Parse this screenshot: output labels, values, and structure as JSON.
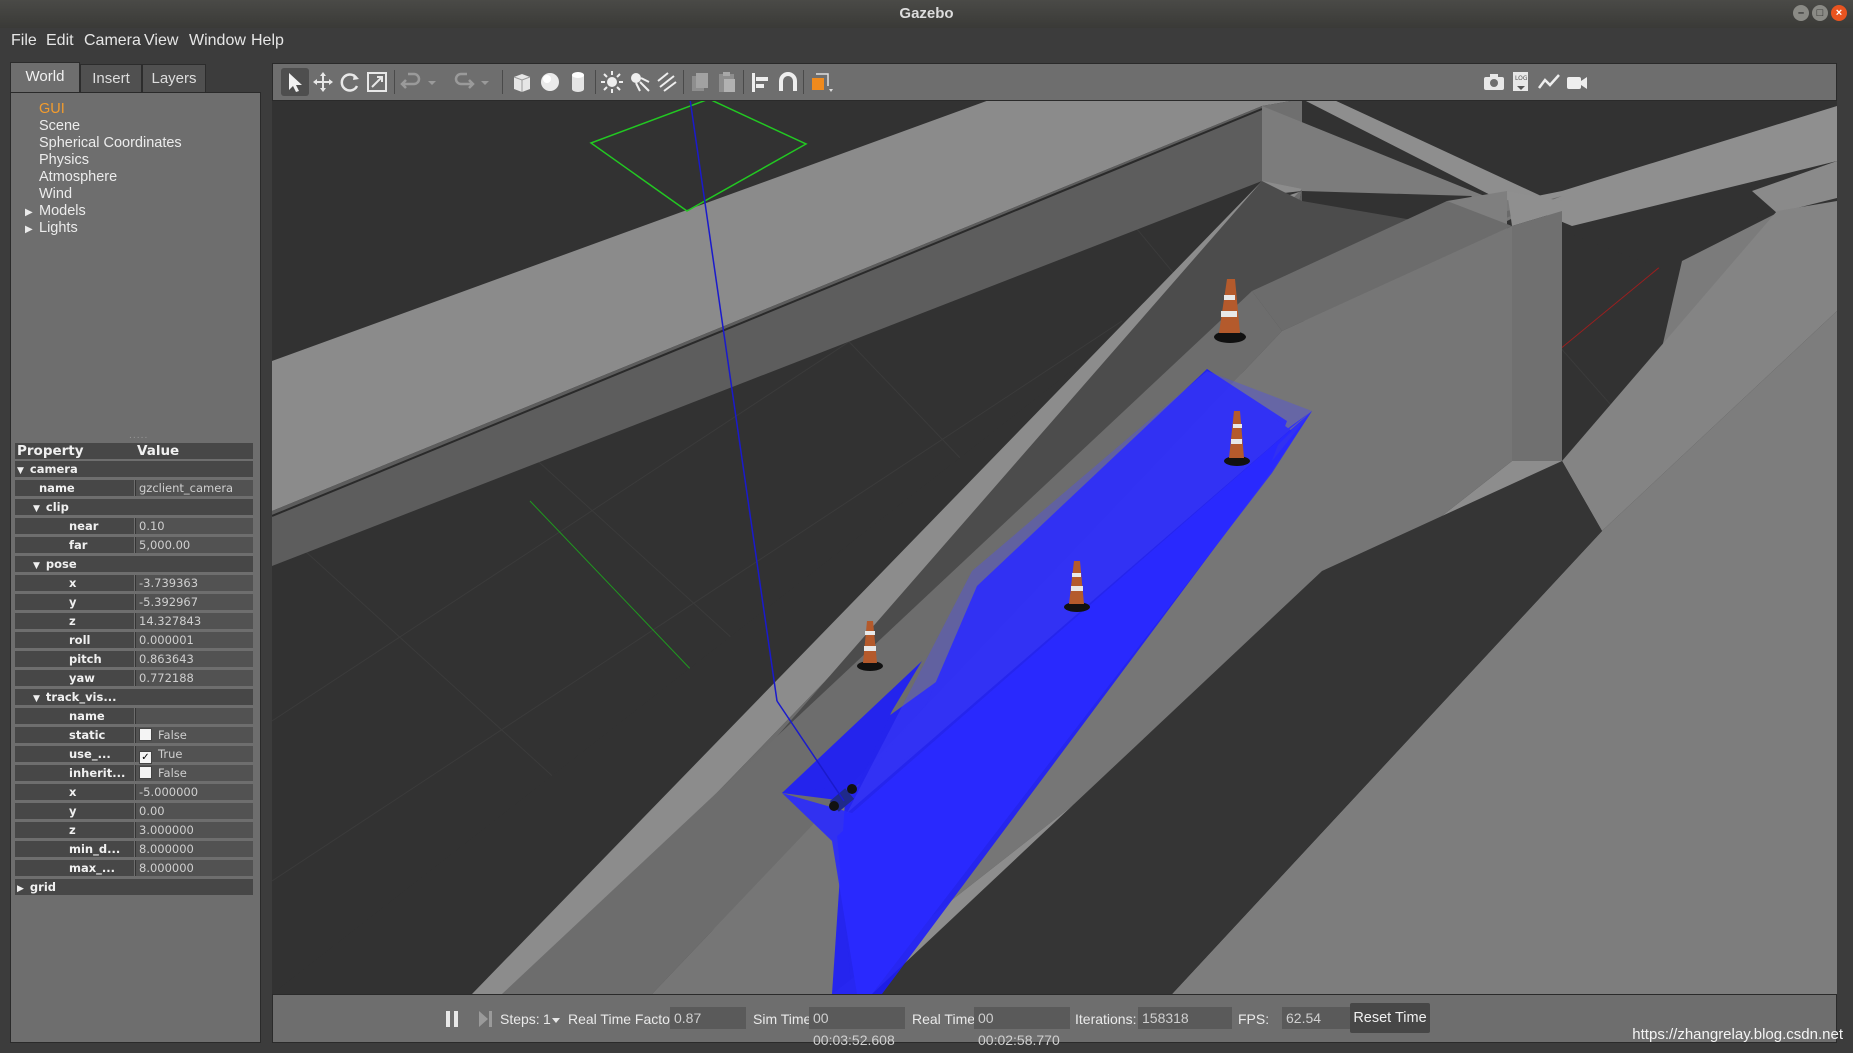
{
  "window": {
    "title": "Gazebo"
  },
  "menu": [
    "File",
    "Edit",
    "Camera",
    "View",
    "Window",
    "Help"
  ],
  "left_panel": {
    "tabs": [
      "World",
      "Insert",
      "Layers"
    ],
    "active_tab": "World",
    "tree": [
      {
        "label": "GUI",
        "selected": true,
        "expandable": false
      },
      {
        "label": "Scene",
        "selected": false,
        "expandable": false
      },
      {
        "label": "Spherical Coordinates",
        "selected": false,
        "expandable": false
      },
      {
        "label": "Physics",
        "selected": false,
        "expandable": false
      },
      {
        "label": "Atmosphere",
        "selected": false,
        "expandable": false
      },
      {
        "label": "Wind",
        "selected": false,
        "expandable": false
      },
      {
        "label": "Models",
        "selected": false,
        "expandable": true
      },
      {
        "label": "Lights",
        "selected": false,
        "expandable": true
      }
    ],
    "property_header": {
      "property": "Property",
      "value": "Value"
    },
    "properties": [
      {
        "type": "group",
        "label": "camera",
        "level": 0,
        "expanded": true
      },
      {
        "type": "row",
        "label": "name",
        "value": "gzclient_camera",
        "level": 1
      },
      {
        "type": "group",
        "label": "clip",
        "level": 1,
        "expanded": true
      },
      {
        "type": "row",
        "label": "near",
        "value": "0.10",
        "level": 2
      },
      {
        "type": "row",
        "label": "far",
        "value": "5,000.00",
        "level": 2
      },
      {
        "type": "group",
        "label": "pose",
        "level": 1,
        "expanded": true
      },
      {
        "type": "row",
        "label": "x",
        "value": "-3.739363",
        "level": 2
      },
      {
        "type": "row",
        "label": "y",
        "value": "-5.392967",
        "level": 2
      },
      {
        "type": "row",
        "label": "z",
        "value": "14.327843",
        "level": 2
      },
      {
        "type": "row",
        "label": "roll",
        "value": "0.000001",
        "level": 2
      },
      {
        "type": "row",
        "label": "pitch",
        "value": "0.863643",
        "level": 2
      },
      {
        "type": "row",
        "label": "yaw",
        "value": "0.772188",
        "level": 2
      },
      {
        "type": "group",
        "label": "track_vis...",
        "level": 1,
        "expanded": true
      },
      {
        "type": "row",
        "label": "name",
        "value": "",
        "level": 2
      },
      {
        "type": "check",
        "label": "static",
        "value": "False",
        "checked": false,
        "level": 2
      },
      {
        "type": "check",
        "label": "use_...",
        "value": "True",
        "checked": true,
        "level": 2
      },
      {
        "type": "check",
        "label": "inherit...",
        "value": "False",
        "checked": false,
        "level": 2
      },
      {
        "type": "row",
        "label": "x",
        "value": "-5.000000",
        "level": 2
      },
      {
        "type": "row",
        "label": "y",
        "value": "0.00",
        "level": 2
      },
      {
        "type": "row",
        "label": "z",
        "value": "3.000000",
        "level": 2
      },
      {
        "type": "row",
        "label": "min_d...",
        "value": "8.000000",
        "level": 2
      },
      {
        "type": "row",
        "label": "max_...",
        "value": "8.000000",
        "level": 2
      },
      {
        "type": "group",
        "label": "grid",
        "level": 0,
        "expanded": false
      }
    ]
  },
  "toolbar": {
    "left_tools": [
      "select-mode-icon",
      "translate-mode-icon",
      "rotate-mode-icon",
      "scale-mode-icon",
      "undo-icon",
      "undo-dropdown-icon",
      "redo-icon",
      "redo-dropdown-icon",
      "box-shape-icon",
      "sphere-shape-icon",
      "cylinder-shape-icon",
      "point-light-icon",
      "spot-light-icon",
      "directional-light-icon",
      "copy-icon",
      "paste-icon",
      "align-icon",
      "snap-icon",
      "view-angle-icon"
    ],
    "right_tools": [
      "screenshot-icon",
      "log-icon",
      "plot-icon",
      "video-record-icon"
    ]
  },
  "bottom_bar": {
    "steps_label": "Steps:",
    "steps_value": "1",
    "rtf_label": "Real Time Factor:",
    "rtf_value": "0.87",
    "sim_time_label": "Sim Time:",
    "sim_time_value": "00 00:03:52.608",
    "real_time_label": "Real Time:",
    "real_time_value": "00 00:02:58.770",
    "iterations_label": "Iterations:",
    "iterations_value": "158318",
    "fps_label": "FPS:",
    "fps_value": "62.54",
    "reset_label": "Reset Time"
  },
  "watermark": "https://zhangrelay.blog.csdn.net",
  "colors": {
    "accent": "#f39c2e",
    "laser": "#1a1aff",
    "close": "#e95420"
  }
}
